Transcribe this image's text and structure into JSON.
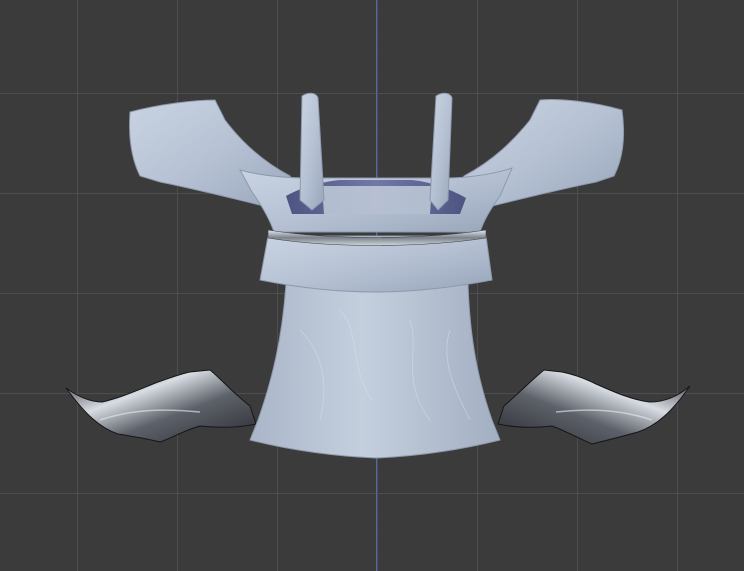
{
  "viewport": {
    "background_color": "#3b3b3b",
    "grid_minor_color": "#444444",
    "grid_major_color": "#505050",
    "axis_color": "#4a6bb0"
  },
  "model": {
    "cloth_color": "#b9c5d6",
    "cloth_shadow_color": "#8b98ac",
    "inner_color": "#5c628c",
    "metal_color": "#9ea4ac",
    "metal_dark_color": "#2a2c30"
  }
}
